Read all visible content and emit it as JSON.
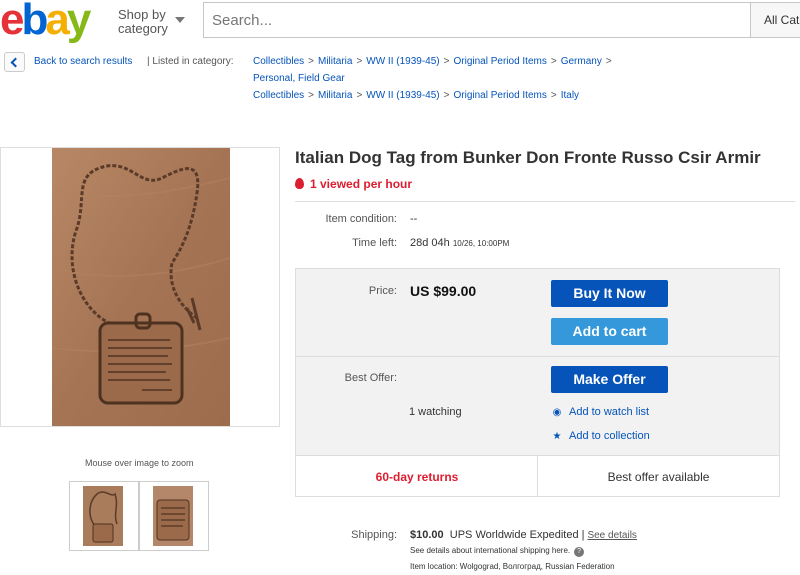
{
  "header": {
    "logo_letters": [
      {
        "char": "e",
        "color": "#e53238"
      },
      {
        "char": "b",
        "color": "#0064d2"
      },
      {
        "char": "a",
        "color": "#f5af02"
      },
      {
        "char": "y",
        "color": "#86b817"
      }
    ],
    "shop_by_line1": "Shop by",
    "shop_by_line2": "category",
    "search_placeholder": "Search...",
    "category_select": "All Categories"
  },
  "breadcrumb": {
    "back_label": "Back to search results",
    "listed_in_label": "| Listed in category:",
    "path1": [
      "Collectibles",
      "Militaria",
      "WW II (1939-45)",
      "Original Period Items",
      "Germany"
    ],
    "path1_cont": "Personal, Field Gear",
    "path2": [
      "Collectibles",
      "Militaria",
      "WW II (1939-45)",
      "Original Period Items",
      "Italy"
    ],
    "separator": ">"
  },
  "gallery": {
    "zoom_caption": "Mouse over image to zoom",
    "thumbnail_count": 2
  },
  "item": {
    "title": "Italian Dog Tag from Bunker Don Fronte Russo Csir Armir",
    "viewed": "1 viewed per hour",
    "condition_label": "Item condition:",
    "condition_value": "--",
    "time_left_label": "Time left:",
    "time_left_value": "28d 04h",
    "time_left_date": "10/26, 10:00PM"
  },
  "purchase": {
    "price_label": "Price:",
    "price_value": "US $99.00",
    "buy_now_label": "Buy It Now",
    "add_to_cart_label": "Add to cart",
    "best_offer_label": "Best Offer:",
    "make_offer_label": "Make Offer",
    "watching": "1 watching",
    "add_to_watch_list": "Add to watch list",
    "add_to_collection": "Add to collection",
    "returns": "60-day returns",
    "best_offer_available": "Best offer available"
  },
  "shipping": {
    "label": "Shipping:",
    "price": "$10.00",
    "service": "UPS Worldwide Expedited",
    "separator": "|",
    "see_details": "See details",
    "intl_note": "See details about international shipping here.",
    "help_glyph": "?",
    "location": "Item location:  Wolgograd, Волгоград, Russian Federation"
  },
  "colors": {
    "link": "#0654ba",
    "accent_red": "#dd1e31",
    "button_primary": "#0654ba",
    "button_secondary": "#3498db"
  }
}
